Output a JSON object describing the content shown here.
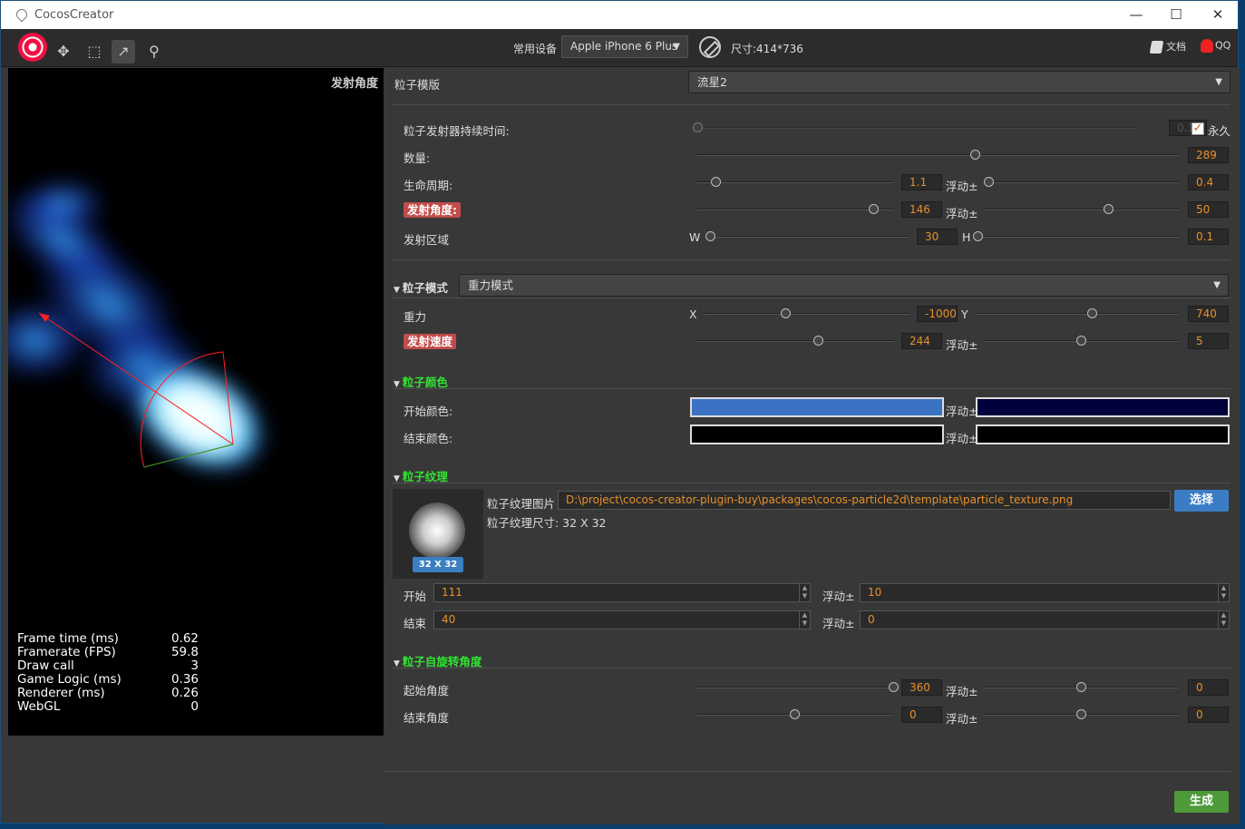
{
  "window": {
    "title": "CocosCreator",
    "min": "—",
    "max": "☐",
    "close": "✕"
  },
  "toolbar": {
    "device_label": "常用设备",
    "device_value": "Apple iPhone 6 Plus",
    "size_label": "尺寸:414*736",
    "doc_label": "文档",
    "qq_label": "QQ"
  },
  "preview": {
    "title": "发射角度",
    "stats": [
      {
        "k": "Frame time (ms)",
        "v": "0.62"
      },
      {
        "k": "Framerate (FPS)",
        "v": "59.8"
      },
      {
        "k": "Draw call",
        "v": "3"
      },
      {
        "k": "Game Logic (ms)",
        "v": "0.36"
      },
      {
        "k": "Renderer (ms)",
        "v": "0.26"
      },
      {
        "k": "WebGL",
        "v": "0"
      }
    ]
  },
  "panel": {
    "template_label": "粒子模版",
    "template_value": "流星2",
    "duration_label": "粒子发射器持续时间:",
    "duration_value": "0.1",
    "forever_label": "永久",
    "count_label": "数量:",
    "count_value": "289",
    "life_label": "生命周期:",
    "life_value": "1.1",
    "life_var_value": "0.4",
    "angle_label": "发射角度:",
    "angle_value": "146",
    "angle_var_value": "50",
    "area_label": "发射区域",
    "area_w_label": "W",
    "area_w_value": "30",
    "area_h_label": "H",
    "area_h_value": "0.1",
    "var_label": "浮动±",
    "mode_section": "粒子模式",
    "mode_value": "重力模式",
    "gravity_label": "重力",
    "gravity_x_label": "X",
    "gravity_x_value": "-1000",
    "gravity_y_label": "Y",
    "gravity_y_value": "740",
    "speed_label": "发射速度",
    "speed_value": "244",
    "speed_var_value": "5",
    "color_section": "粒子颜色",
    "start_color_label": "开始颜色:",
    "end_color_label": "结束颜色:",
    "start_color": "#3a73c4",
    "start_color_var": "#00003c",
    "end_color": "#000000",
    "end_color_var": "#000000",
    "texture_section": "粒子纹理",
    "texture_img_label": "粒子纹理图片",
    "texture_path": "D:\\project\\cocos-creator-plugin-buy\\packages\\cocos-particle2d\\template\\particle_texture.png",
    "select_btn": "选择",
    "texture_size_label": "粒子纹理尺寸: 32 X 32",
    "texture_badge": "32 X 32",
    "start_label": "开始",
    "start_value": "111",
    "start_var_value": "10",
    "end_label": "结束",
    "end_value": "40",
    "end_var_value": "0",
    "spin_section": "粒子自旋转角度",
    "spin_start_label": "起始角度",
    "spin_start_value": "360",
    "spin_start_var_value": "0",
    "spin_end_label": "结束角度",
    "spin_end_value": "0",
    "spin_end_var_value": "0",
    "generate_btn": "生成"
  }
}
